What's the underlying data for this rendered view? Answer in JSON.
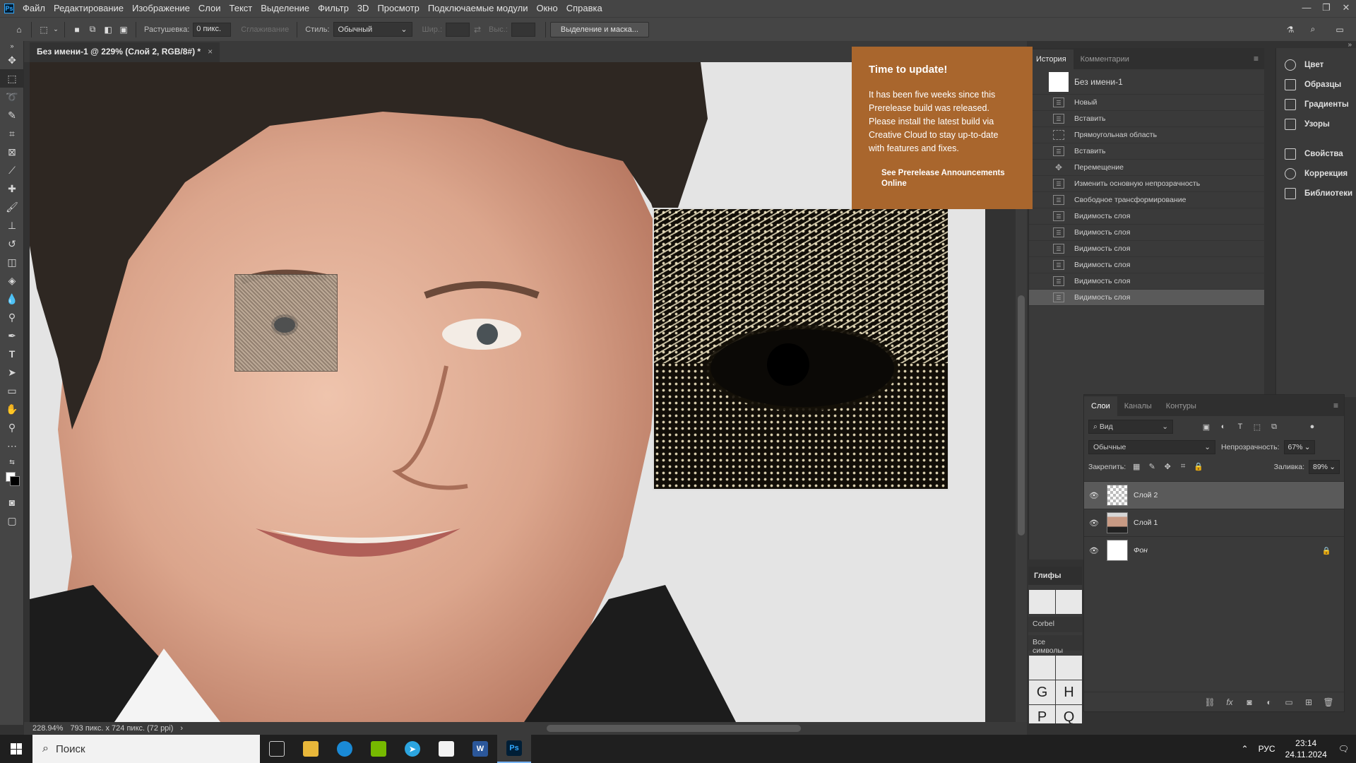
{
  "menu": {
    "logo": "Ps",
    "items": [
      "Файл",
      "Редактирование",
      "Изображение",
      "Слои",
      "Текст",
      "Выделение",
      "Фильтр",
      "3D",
      "Просмотр",
      "Подключаемые модули",
      "Окно",
      "Справка"
    ]
  },
  "options": {
    "feather_label": "Растушевка:",
    "feather_value": "0 пикс.",
    "antialias_label": "Сглаживание",
    "style_label": "Стиль:",
    "style_value": "Обычный",
    "width_label": "Шир.:",
    "height_label": "Выс.:",
    "select_mask_button": "Выделение и маска..."
  },
  "document": {
    "tab_title": "Без имени-1 @ 229% (Слой 2, RGB/8#) *",
    "zoom": "228.94%",
    "size_info": "793 пикс. x 724 пикс. (72 ppi)"
  },
  "popup": {
    "title": "Time to update!",
    "body": "It has been five weeks since this Prerelease build was released. Please install the latest build via Creative Cloud to stay up-to-date with features and fixes.",
    "link": "See Prerelease Announcements Online"
  },
  "history": {
    "tabs": [
      "История",
      "Комментарии"
    ],
    "snapshot": "Без имени-1",
    "items": [
      "Новый",
      "Вставить",
      "Прямоугольная область",
      "Вставить",
      "Перемещение",
      "Изменить основную непрозрачность",
      "Свободное трансформирование",
      "Видимость слоя",
      "Видимость слоя",
      "Видимость слоя",
      "Видимость слоя",
      "Видимость слоя",
      "Видимость слоя"
    ]
  },
  "right_panels": [
    "Цвет",
    "Образцы",
    "Градиенты",
    "Узоры",
    "Свойства",
    "Коррекция",
    "Библиотеки"
  ],
  "glyphs": {
    "title": "Глифы",
    "font": "Corbel",
    "set": "Все символы",
    "chars": [
      "G",
      "H",
      "P",
      "Q"
    ]
  },
  "layers": {
    "tabs": [
      "Слои",
      "Каналы",
      "Контуры"
    ],
    "filter": "Вид",
    "blend_mode": "Обычные",
    "opacity_label": "Непрозрачность:",
    "opacity_value": "67%",
    "lock_label": "Закрепить:",
    "fill_label": "Заливка:",
    "fill_value": "89%",
    "items": [
      "Слой 2",
      "Слой 1",
      "Фон"
    ]
  },
  "taskbar": {
    "search_placeholder": "Поиск",
    "lang": "РУС",
    "time": "23:14",
    "date": "24.11.2024"
  }
}
